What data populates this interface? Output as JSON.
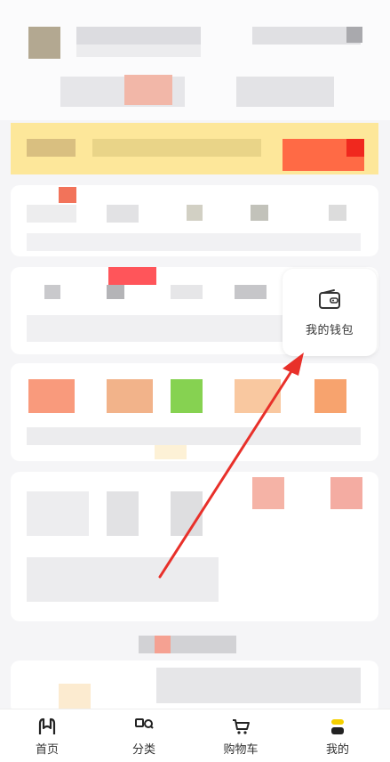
{
  "wallet": {
    "label": "我的钱包",
    "icon": "wallet-icon"
  },
  "tabbar": {
    "items": [
      {
        "label": "首页",
        "icon": "home-icon"
      },
      {
        "label": "分类",
        "icon": "category-icon"
      },
      {
        "label": "购物车",
        "icon": "cart-icon"
      },
      {
        "label": "我的",
        "icon": "profile-icon"
      }
    ]
  },
  "annotation": {
    "arrow_color": "#e8302a"
  },
  "colors": {
    "banner": "#fde79a",
    "accent_red": "#ff4a3d",
    "accent_green": "#7dcc3a"
  }
}
